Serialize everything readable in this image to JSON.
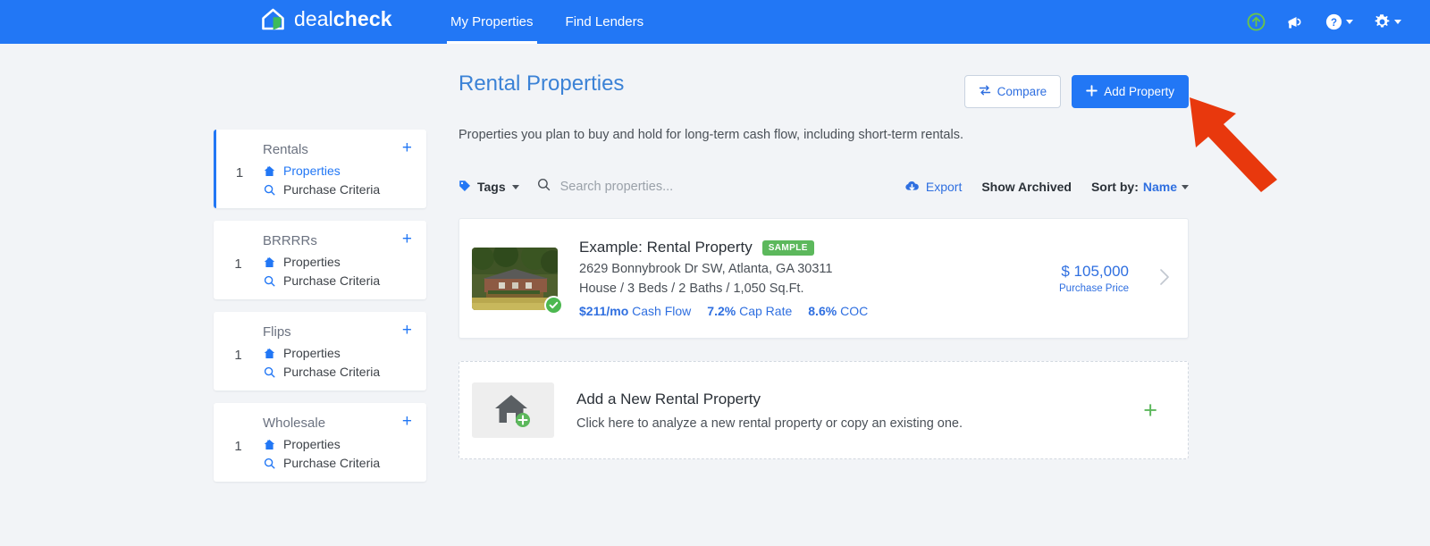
{
  "header": {
    "brand_first": "deal",
    "brand_second": "check",
    "nav": [
      {
        "label": "My Properties",
        "active": true
      },
      {
        "label": "Find Lenders",
        "active": false
      }
    ],
    "actions": [
      {
        "name": "upgrade-icon",
        "label": ""
      },
      {
        "name": "megaphone-icon",
        "label": ""
      },
      {
        "name": "help-icon",
        "label": ""
      },
      {
        "name": "gear-icon",
        "label": ""
      }
    ],
    "brand_color": "#2277f5"
  },
  "sidebar": {
    "cards": [
      {
        "title": "Rentals",
        "count": "1",
        "plus": "+",
        "properties_label": "Properties",
        "criteria_label": "Purchase Criteria",
        "active": true
      },
      {
        "title": "BRRRRs",
        "count": "1",
        "plus": "+",
        "properties_label": "Properties",
        "criteria_label": "Purchase Criteria",
        "active": false
      },
      {
        "title": "Flips",
        "count": "1",
        "plus": "+",
        "properties_label": "Properties",
        "criteria_label": "Purchase Criteria",
        "active": false
      },
      {
        "title": "Wholesale",
        "count": "1",
        "plus": "+",
        "properties_label": "Properties",
        "criteria_label": "Purchase Criteria",
        "active": false
      }
    ]
  },
  "main": {
    "title": "Rental Properties",
    "subtitle": "Properties you plan to buy and hold for long-term cash flow, including short-term rentals.",
    "compare_label": "Compare",
    "add_property_label": "Add Property",
    "toolbar": {
      "tags_label": "Tags",
      "search_placeholder": "Search properties...",
      "search_value": "",
      "export_label": "Export",
      "show_archived_label": "Show Archived",
      "sort_by_label": "Sort by:",
      "sort_by_value": "Name"
    },
    "property": {
      "name": "Example: Rental Property",
      "badge": "SAMPLE",
      "address": "2629 Bonnybrook Dr SW, Atlanta, GA 30311",
      "specs": "House / 3 Beds / 2 Baths / 1,050 Sq.Ft.",
      "metric_cashflow": "$211/mo",
      "metric_cashflow_label": "Cash Flow",
      "metric_caprate": "7.2%",
      "metric_caprate_label": "Cap Rate",
      "metric_coc": "8.6%",
      "metric_coc_label": "COC",
      "price": "$ 105,000",
      "price_label": "Purchase Price"
    },
    "add_card": {
      "title": "Add a New Rental Property",
      "subtitle": "Click here to analyze a new rental property or copy an existing one.",
      "plus": "+"
    }
  },
  "annotation": {
    "arrow_color": "#e8380d",
    "points_to": "Add Property"
  }
}
